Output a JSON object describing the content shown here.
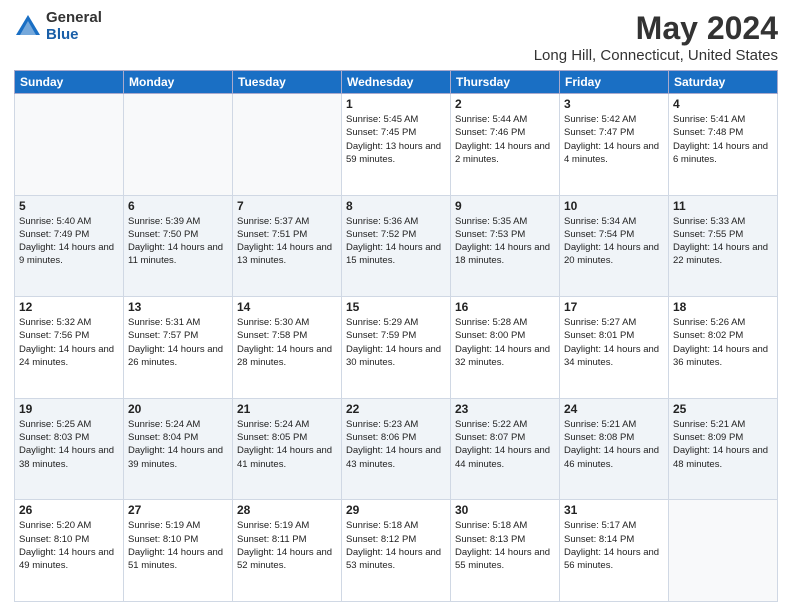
{
  "logo": {
    "general": "General",
    "blue": "Blue"
  },
  "title": "May 2024",
  "subtitle": "Long Hill, Connecticut, United States",
  "days_of_week": [
    "Sunday",
    "Monday",
    "Tuesday",
    "Wednesday",
    "Thursday",
    "Friday",
    "Saturday"
  ],
  "weeks": [
    [
      {
        "day": "",
        "info": ""
      },
      {
        "day": "",
        "info": ""
      },
      {
        "day": "",
        "info": ""
      },
      {
        "day": "1",
        "info": "Sunrise: 5:45 AM\nSunset: 7:45 PM\nDaylight: 13 hours and 59 minutes."
      },
      {
        "day": "2",
        "info": "Sunrise: 5:44 AM\nSunset: 7:46 PM\nDaylight: 14 hours and 2 minutes."
      },
      {
        "day": "3",
        "info": "Sunrise: 5:42 AM\nSunset: 7:47 PM\nDaylight: 14 hours and 4 minutes."
      },
      {
        "day": "4",
        "info": "Sunrise: 5:41 AM\nSunset: 7:48 PM\nDaylight: 14 hours and 6 minutes."
      }
    ],
    [
      {
        "day": "5",
        "info": "Sunrise: 5:40 AM\nSunset: 7:49 PM\nDaylight: 14 hours and 9 minutes."
      },
      {
        "day": "6",
        "info": "Sunrise: 5:39 AM\nSunset: 7:50 PM\nDaylight: 14 hours and 11 minutes."
      },
      {
        "day": "7",
        "info": "Sunrise: 5:37 AM\nSunset: 7:51 PM\nDaylight: 14 hours and 13 minutes."
      },
      {
        "day": "8",
        "info": "Sunrise: 5:36 AM\nSunset: 7:52 PM\nDaylight: 14 hours and 15 minutes."
      },
      {
        "day": "9",
        "info": "Sunrise: 5:35 AM\nSunset: 7:53 PM\nDaylight: 14 hours and 18 minutes."
      },
      {
        "day": "10",
        "info": "Sunrise: 5:34 AM\nSunset: 7:54 PM\nDaylight: 14 hours and 20 minutes."
      },
      {
        "day": "11",
        "info": "Sunrise: 5:33 AM\nSunset: 7:55 PM\nDaylight: 14 hours and 22 minutes."
      }
    ],
    [
      {
        "day": "12",
        "info": "Sunrise: 5:32 AM\nSunset: 7:56 PM\nDaylight: 14 hours and 24 minutes."
      },
      {
        "day": "13",
        "info": "Sunrise: 5:31 AM\nSunset: 7:57 PM\nDaylight: 14 hours and 26 minutes."
      },
      {
        "day": "14",
        "info": "Sunrise: 5:30 AM\nSunset: 7:58 PM\nDaylight: 14 hours and 28 minutes."
      },
      {
        "day": "15",
        "info": "Sunrise: 5:29 AM\nSunset: 7:59 PM\nDaylight: 14 hours and 30 minutes."
      },
      {
        "day": "16",
        "info": "Sunrise: 5:28 AM\nSunset: 8:00 PM\nDaylight: 14 hours and 32 minutes."
      },
      {
        "day": "17",
        "info": "Sunrise: 5:27 AM\nSunset: 8:01 PM\nDaylight: 14 hours and 34 minutes."
      },
      {
        "day": "18",
        "info": "Sunrise: 5:26 AM\nSunset: 8:02 PM\nDaylight: 14 hours and 36 minutes."
      }
    ],
    [
      {
        "day": "19",
        "info": "Sunrise: 5:25 AM\nSunset: 8:03 PM\nDaylight: 14 hours and 38 minutes."
      },
      {
        "day": "20",
        "info": "Sunrise: 5:24 AM\nSunset: 8:04 PM\nDaylight: 14 hours and 39 minutes."
      },
      {
        "day": "21",
        "info": "Sunrise: 5:24 AM\nSunset: 8:05 PM\nDaylight: 14 hours and 41 minutes."
      },
      {
        "day": "22",
        "info": "Sunrise: 5:23 AM\nSunset: 8:06 PM\nDaylight: 14 hours and 43 minutes."
      },
      {
        "day": "23",
        "info": "Sunrise: 5:22 AM\nSunset: 8:07 PM\nDaylight: 14 hours and 44 minutes."
      },
      {
        "day": "24",
        "info": "Sunrise: 5:21 AM\nSunset: 8:08 PM\nDaylight: 14 hours and 46 minutes."
      },
      {
        "day": "25",
        "info": "Sunrise: 5:21 AM\nSunset: 8:09 PM\nDaylight: 14 hours and 48 minutes."
      }
    ],
    [
      {
        "day": "26",
        "info": "Sunrise: 5:20 AM\nSunset: 8:10 PM\nDaylight: 14 hours and 49 minutes."
      },
      {
        "day": "27",
        "info": "Sunrise: 5:19 AM\nSunset: 8:10 PM\nDaylight: 14 hours and 51 minutes."
      },
      {
        "day": "28",
        "info": "Sunrise: 5:19 AM\nSunset: 8:11 PM\nDaylight: 14 hours and 52 minutes."
      },
      {
        "day": "29",
        "info": "Sunrise: 5:18 AM\nSunset: 8:12 PM\nDaylight: 14 hours and 53 minutes."
      },
      {
        "day": "30",
        "info": "Sunrise: 5:18 AM\nSunset: 8:13 PM\nDaylight: 14 hours and 55 minutes."
      },
      {
        "day": "31",
        "info": "Sunrise: 5:17 AM\nSunset: 8:14 PM\nDaylight: 14 hours and 56 minutes."
      },
      {
        "day": "",
        "info": ""
      }
    ]
  ]
}
